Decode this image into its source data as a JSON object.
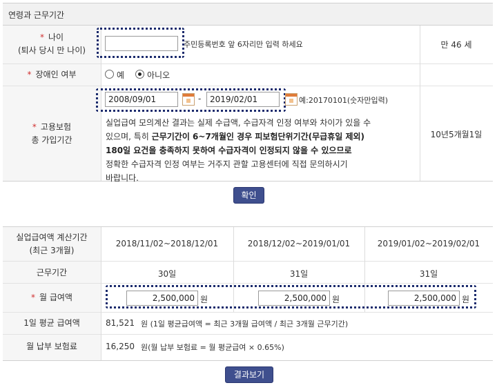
{
  "section1": {
    "title": "연령과 근무기간",
    "age": {
      "label_required": "*",
      "label": "나이",
      "label_sub": "(퇴사 당시 만 나이)",
      "input_value": "",
      "hint": "주민등록번호 앞 6자리만 입력 하세요",
      "result": "만 46 세"
    },
    "disability": {
      "label_required": "*",
      "label": "장애인 여부",
      "option_yes": "예",
      "option_no": "아니오",
      "selected": "아니오"
    },
    "insurance": {
      "label_required": "*",
      "label": "고용보험",
      "label_sub": "총 가입기간",
      "start_date": "2008/09/01",
      "separator": "-",
      "end_date": "2019/02/01",
      "date_hint": "예:20170101(숫자만입력)",
      "notice_1": "실업급여 모의계산 결과는 실제 수급액, 수급자격 인정 여부와 차이가 있을 수",
      "notice_2a": "있으며, 특히 ",
      "notice_2b": "근무기간이 6~7개월인 경우 피보험단위기간(무급휴일 제외)",
      "notice_3": "180일 요건을 충족하지 못하여 수급자격이 인정되지 않을 수 있으므로",
      "notice_4": "정확한 수급자격 인정 여부는 거주지 관할 고용센터에 직접 문의하시기",
      "notice_5": "바랍니다.",
      "result": "10년5개월1일"
    },
    "confirm_button": "확인"
  },
  "section2": {
    "period_label": "실업급여액 계산기간",
    "period_label_sub": "(최근 3개월)",
    "periods": [
      "2018/11/02~2018/12/01",
      "2018/12/02~2019/01/01",
      "2019/01/02~2019/02/01"
    ],
    "work_days_label": "근무기간",
    "work_days": [
      "30일",
      "31일",
      "31일"
    ],
    "salary_label_required": "*",
    "salary_label": "월 급여액",
    "salaries": [
      "2,500,000",
      "2,500,000",
      "2,500,000"
    ],
    "currency_unit": "원",
    "daily_avg_label": "1일 평균 급여액",
    "daily_avg_value": "81,521",
    "daily_avg_desc": "원 (1일 평균급여액 = 최근 3개월 급여액 / 최근 3개월 근무기간)",
    "premium_label": "월 납부 보험료",
    "premium_value": "16,250",
    "premium_desc": "원(월 납부 보험료 = 월 평균급여 × 0.65%)",
    "result_button": "결과보기"
  },
  "colors": {
    "button_bg": "#3f4f8e",
    "dotted_highlight": "#1a2a6c",
    "required_mark": "#d03030",
    "calendar_icon": "#e07b39"
  }
}
